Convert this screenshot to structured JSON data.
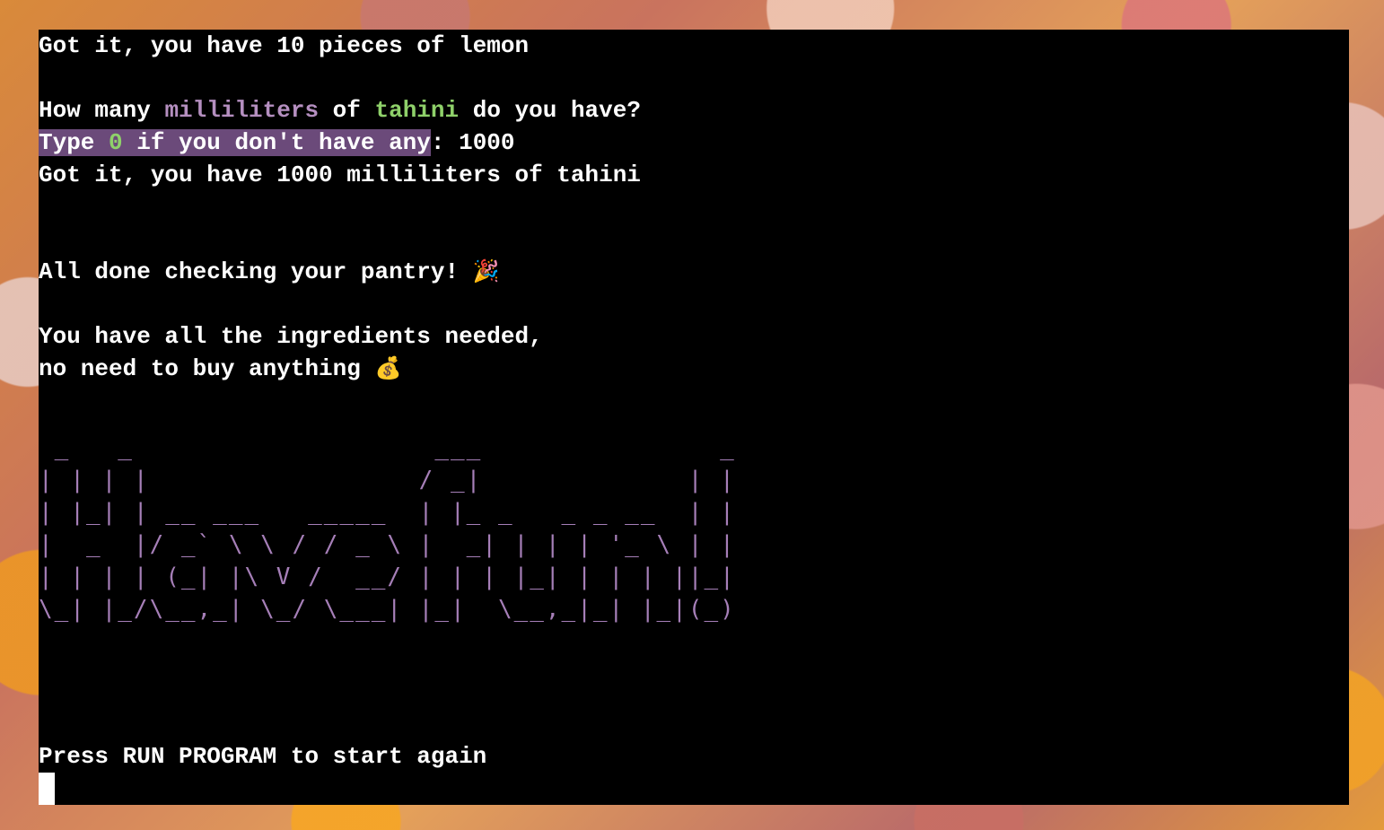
{
  "terminal": {
    "line1": "Got it, you have 10 pieces of lemon",
    "question": {
      "prefix": "How many ",
      "unit": "milliliters",
      "middle": " of ",
      "ingredient": "tahini",
      "suffix": " do you have?"
    },
    "prompt": {
      "type_label": "Type ",
      "zero": "0",
      "rest": " if you don't have any",
      "colon": ":",
      "user_input": " 1000"
    },
    "confirm": "Got it, you have 1000 milliliters of tahini",
    "done": "All done checking your pantry! ",
    "done_emoji": "🎉",
    "result_line1": "You have all the ingredients needed,",
    "result_line2": "no need to buy anything ",
    "result_emoji": "💰",
    "ascii_art": " _   _                   ___               _ \n| | | |                 / _|             | |\n| |_| | __ ___   _____  | |_ _   _ _ __  | |\n|  _  |/ _` \\ \\ / / _ \\ |  _| | | | '_ \\ | |\n| | | | (_| |\\ V /  __/ | | | |_| | | | ||_|\n\\_| |_/\\__,_| \\_/ \\___| |_|  \\__,_|_| |_|(_)",
    "footer": "Press RUN PROGRAM to start again"
  },
  "colors": {
    "accent_purple": "#b58fc0",
    "accent_green": "#8fd16a",
    "highlight": "#6b4a7a"
  }
}
